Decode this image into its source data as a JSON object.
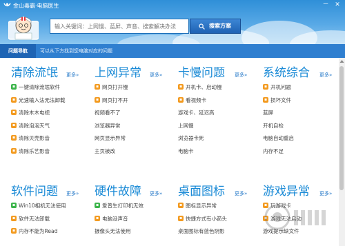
{
  "window": {
    "title": "金山毒霸·电脑医生",
    "buttons": {
      "minimize": "－",
      "close": "✕"
    }
  },
  "search": {
    "placeholder": "输入关键词：上网慢、蓝屏、声音、搜索解决办法",
    "button_label": "搜索方案"
  },
  "nav": {
    "tab_label": "问题导航",
    "hint": "可以从下方找到您电脑对应的问题"
  },
  "more_label": "更多»",
  "categories": [
    {
      "title": "清除流氓",
      "items": [
        {
          "label": "一键清除流氓软件",
          "badge": "green"
        },
        {
          "label": "光速输入法无法卸载",
          "badge": "orange"
        },
        {
          "label": "清除木木电视",
          "badge": "orange"
        },
        {
          "label": "清除泡泡天气",
          "badge": "orange"
        },
        {
          "label": "清除贝壳影音",
          "badge": "orange"
        },
        {
          "label": "清除乐艺影音",
          "badge": "orange"
        }
      ]
    },
    {
      "title": "上网异常",
      "items": [
        {
          "label": "网页打开慢",
          "badge": "orange"
        },
        {
          "label": "网页打不开",
          "badge": "orange"
        },
        {
          "label": "视频看不了",
          "badge": ""
        },
        {
          "label": "浏览器异常",
          "badge": ""
        },
        {
          "label": "网页显示异常",
          "badge": ""
        },
        {
          "label": "主页被改",
          "badge": ""
        }
      ]
    },
    {
      "title": "卡慢问题",
      "items": [
        {
          "label": "开机卡、启动慢",
          "badge": "orange"
        },
        {
          "label": "看视频卡",
          "badge": "orange"
        },
        {
          "label": "游戏卡、延迟高",
          "badge": ""
        },
        {
          "label": "上网慢",
          "badge": ""
        },
        {
          "label": "浏览器卡死",
          "badge": ""
        },
        {
          "label": "电脑卡",
          "badge": ""
        }
      ]
    },
    {
      "title": "系统综合",
      "items": [
        {
          "label": "开机问题",
          "badge": "orange"
        },
        {
          "label": "损坏文件",
          "badge": "orange"
        },
        {
          "label": "蓝屏",
          "badge": ""
        },
        {
          "label": "开机自检",
          "badge": ""
        },
        {
          "label": "电脑自动重启",
          "badge": ""
        },
        {
          "label": "内存不足",
          "badge": ""
        }
      ]
    },
    {
      "title": "软件问题",
      "items": [
        {
          "label": "Win10相机无法使用",
          "badge": "green"
        },
        {
          "label": "软件无法卸载",
          "badge": "orange"
        },
        {
          "label": "内存不能为Read",
          "badge": "orange"
        }
      ]
    },
    {
      "title": "硬件故障",
      "items": [
        {
          "label": "爱普生打印机无效",
          "badge": "green"
        },
        {
          "label": "电脑没声音",
          "badge": "orange"
        },
        {
          "label": "摄像头无法使用",
          "badge": ""
        }
      ]
    },
    {
      "title": "桌面图标",
      "items": [
        {
          "label": "图标显示异常",
          "badge": "orange"
        },
        {
          "label": "快捷方式有小箭头",
          "badge": "orange"
        },
        {
          "label": "桌面图标有蓝色阴影",
          "badge": ""
        }
      ]
    },
    {
      "title": "游戏异常",
      "items": [
        {
          "label": "玩游戏卡",
          "badge": "orange"
        },
        {
          "label": "游戏无法启动",
          "badge": "orange"
        },
        {
          "label": "游戏提示缺文件",
          "badge": ""
        }
      ]
    }
  ],
  "colors": {
    "header_blue": "#2f8fd8",
    "nav_blue": "#2f7fd0",
    "category_title": "#1a8ad6",
    "badge_orange": "#f39a1f",
    "badge_green": "#3bb44a"
  }
}
